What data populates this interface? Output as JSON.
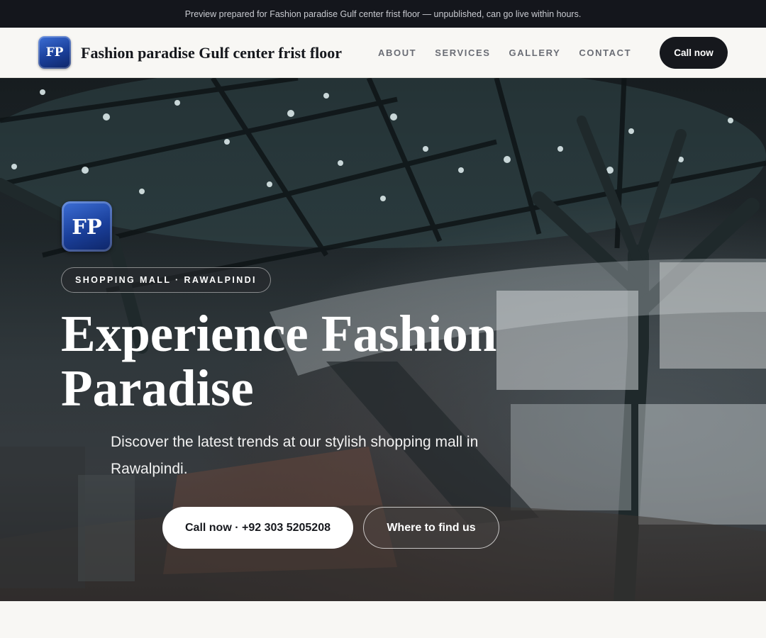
{
  "banner": {
    "text": "Preview prepared for Fashion paradise Gulf center frist floor — unpublished, can go live within hours."
  },
  "header": {
    "logo_initials": "FP",
    "brand_name": "Fashion paradise Gulf center frist floor",
    "nav": [
      {
        "label": "ABOUT"
      },
      {
        "label": "SERVICES"
      },
      {
        "label": "GALLERY"
      },
      {
        "label": "CONTACT"
      }
    ],
    "cta_label": "Call now"
  },
  "hero": {
    "logo_initials": "FP",
    "tag": "SHOPPING MALL · RAWALPINDI",
    "title": "Experience Fashion Paradise",
    "subtitle": "Discover the latest trends at our stylish shopping mall in Rawalpindi.",
    "primary_button": "Call now · +92 303 5205208",
    "secondary_button": "Where to find us"
  },
  "colors": {
    "banner_bg": "#14161c",
    "nav_bg": "#f8f7f4",
    "dark_button": "#16181d",
    "logo_blue": "#1a3f9a"
  }
}
